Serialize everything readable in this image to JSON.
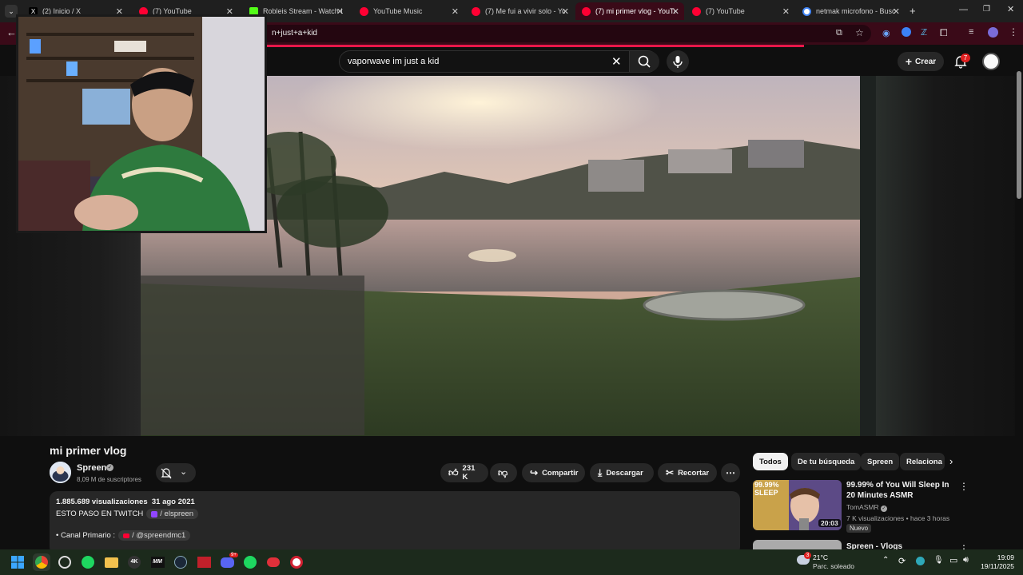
{
  "browser": {
    "tabs": [
      {
        "label": "(2) Inicio / X",
        "favicon_color": "#000000"
      },
      {
        "label": "(7) YouTube",
        "favicon_color": "#ff0033"
      },
      {
        "label": "Robleis Stream - Watch Li",
        "favicon_color": "#53fc18"
      },
      {
        "label": "YouTube Music",
        "favicon_color": "#ff0033"
      },
      {
        "label": "(7) Me fui a vivir solo - Yo",
        "favicon_color": "#ff0033"
      },
      {
        "label": "(7) mi primer vlog - YouTu",
        "favicon_color": "#ff0033",
        "active": true
      },
      {
        "label": "(7) YouTube",
        "favicon_color": "#ff0033"
      },
      {
        "label": "netmak microfono - Busc",
        "favicon_color": "#4285f4"
      }
    ],
    "url_visible": "n+just+a+kid",
    "accent": "#3a0a18"
  },
  "youtube": {
    "search_query": "vaporwave im just a kid",
    "create_label": "Crear",
    "notification_count": "7",
    "video": {
      "title": "mi primer vlog",
      "channel": "Spreen",
      "subscribers": "8,09 M de suscriptores",
      "likes": "231 K",
      "share_label": "Compartir",
      "download_label": "Descargar",
      "clip_label": "Recortar",
      "views": "1.885.689 visualizaciones",
      "date": "31 ago 2021",
      "desc_line1": "ESTO PASO EN TWITCH",
      "desc_link1": "/ elspreen",
      "desc_line2": "• Canal Primario :",
      "desc_link2": "/ @spreendmc1"
    },
    "chips": [
      "Todos",
      "De tu búsqueda",
      "Spreen",
      "Relaciona"
    ],
    "recommendations": [
      {
        "title": "99.99% of You Will Sleep In 20 Minutes ASMR",
        "channel": "TomASMR",
        "meta": "7 K visualizaciones • hace 3 horas",
        "badge": "Nuevo",
        "duration": "20:03",
        "thumb_text": "99.99% SLEEP"
      },
      {
        "title": "Spreen - Vlogs"
      }
    ]
  },
  "taskbar": {
    "weather_temp": "21°C",
    "weather_desc": "Parc. soleado",
    "time": "19:09",
    "date": "19/11/2025",
    "notify_badge": "3",
    "discord_badge": "9+"
  }
}
